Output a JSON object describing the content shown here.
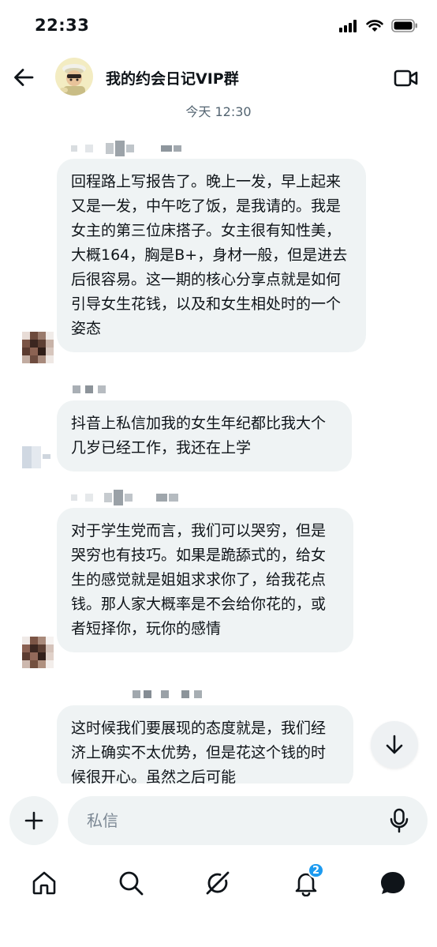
{
  "status_bar": {
    "time": "22:33"
  },
  "header": {
    "title": "我的约会日记VIP群",
    "back_icon": "arrow-left-icon",
    "video_icon": "video-camera-icon"
  },
  "conversation": {
    "timestamp": "今天 12:30",
    "messages": [
      {
        "text": "回程路上写报告了。晚上一发，早上起来又是一发，中午吃了饭，是我请的。我是女主的第三位床搭子。女主很有知性美，大概164，胸是B+，身材一般，但是进去后很容易。这一期的核心分享点就是如何引导女生花钱，以及和女生相处时的一个姿态"
      },
      {
        "text": "抖音上私信加我的女生年纪都比我大个几岁已经工作，我还在上学"
      },
      {
        "text": "对于学生党而言，我们可以哭穷，但是哭穷也有技巧。如果是跪舔式的，给女生的感觉就是姐姐求求你了，给我花点钱。那人家大概率是不会给你花的，或者短择你，玩你的感情"
      },
      {
        "text": "这时候我们要展现的态度就是，我们经济上确实不太优势，但是花这个钱的时候很开心。虽然之后可能"
      }
    ]
  },
  "composer": {
    "placeholder": "私信"
  },
  "bottom_nav": {
    "items": [
      "home-icon",
      "search-icon",
      "grok-icon",
      "notifications-icon",
      "messages-icon"
    ],
    "notification_badge": "2"
  },
  "colors": {
    "accent": "#1d9bf0",
    "bubble": "#eff3f4",
    "muted": "#536471"
  }
}
